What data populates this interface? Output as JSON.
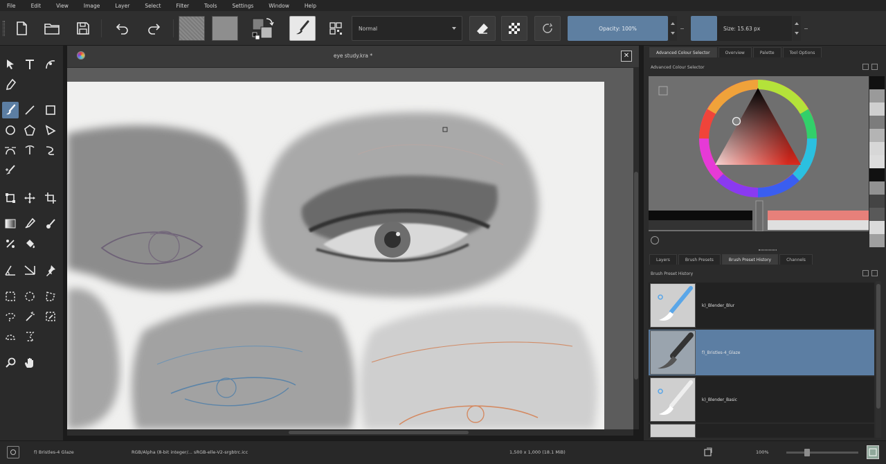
{
  "menu": [
    "File",
    "Edit",
    "View",
    "Image",
    "Layer",
    "Select",
    "Filter",
    "Tools",
    "Settings",
    "Window",
    "Help"
  ],
  "toolbar": {
    "blend_mode": "Normal",
    "opacity": "Opacity: 100%",
    "size": "Size: 15.63 px",
    "brush_colors": {
      "foreground": "#7f7f7f",
      "background": "#b9b9b9"
    }
  },
  "document": {
    "title": "eye study.kra *"
  },
  "dock": {
    "top_tabs": [
      "Advanced Colour Selector",
      "Overview",
      "Palette",
      "Tool Options"
    ],
    "color_panel_title": "Advanced Colour Selector",
    "bottom_tabs": [
      "Layers",
      "Brush Presets",
      "Brush Preset History",
      "Channels"
    ],
    "history_panel_title": "Brush Preset History",
    "brushes": [
      {
        "name": "k)_Blender_Blur"
      },
      {
        "name": "f)_Bristles-4_Glaze"
      },
      {
        "name": "k)_Blender_Basic"
      }
    ],
    "recent_colors": [
      "#111111",
      "#9a9a9a",
      "#cfcfcf",
      "#7c7c7c",
      "#b4b4b4",
      "#d7d7d7",
      "#dcdcdc",
      "#111111",
      "#929292",
      "#444444",
      "#595959",
      "#dadada",
      "#9f9f9f"
    ]
  },
  "status": {
    "brush": "f) Bristles-4 Glaze",
    "color_profile": "RGB/Alpha (8-bit integer/... sRGB-elle-V2-srgbtrc.icc",
    "dimensions": "1,500 x 1,000 (18.1 MiB)",
    "zoom": "100%"
  }
}
